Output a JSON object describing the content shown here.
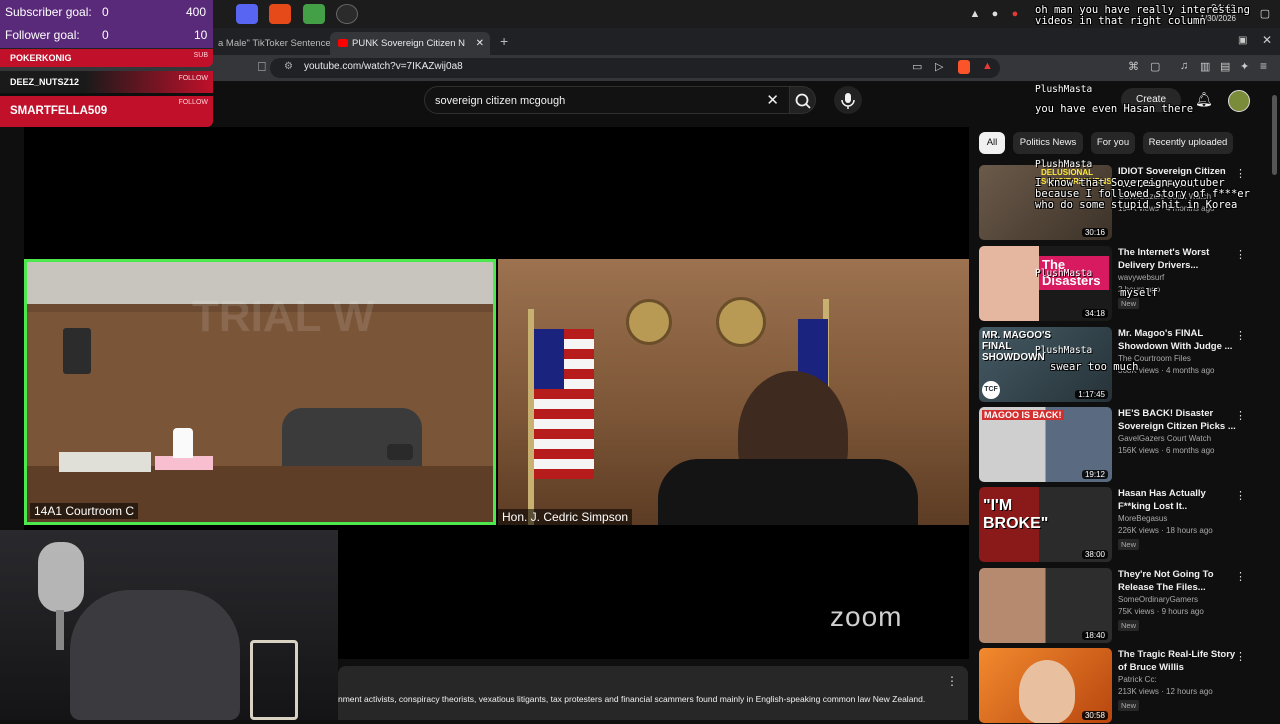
{
  "stream_overlay": {
    "goals": [
      {
        "label": "Subscriber goal:",
        "current": "0",
        "target": "400"
      },
      {
        "label": "Follower goal:",
        "current": "0",
        "target": "10"
      }
    ],
    "alerts": [
      {
        "name": "POKERKONIG",
        "type": "SUB"
      },
      {
        "name": "DEEZ_NUTSZ12",
        "type": "FOLLOW"
      },
      {
        "name": "SMARTFELLA509",
        "type": "FOLLOW"
      }
    ],
    "chat": [
      {
        "user": "",
        "message": "oh man you have really interesting videos in that right column"
      },
      {
        "user": "PlushMasta",
        "message": "you have even Hasan there"
      },
      {
        "user": "PlushMasta",
        "message": "I know that Sovereign youtuber because I followed story of f***er who do some stupid shit in Korea"
      },
      {
        "user": "PlushMasta",
        "message": "myself"
      },
      {
        "user": "PlushMasta",
        "message": "swear too much"
      }
    ]
  },
  "taskbar": {
    "time": "04:41",
    "date": "1/30/2026"
  },
  "browser": {
    "tabs": [
      {
        "label": "a Male\" TikToker Sentence"
      },
      {
        "label": "PUNK Sovereign Citizen N"
      }
    ],
    "url": "youtube.com/watch?v=7IKAZwij0a8"
  },
  "youtube": {
    "search_query": "sovereign citizen mcgough",
    "create_label": "Create",
    "video": {
      "left_pane_label": "14A1 Courtroom C",
      "right_pane_label": "Hon. J. Cedric Simpson",
      "watermark": "TRIAL W",
      "zoom_logo": "zoom"
    },
    "description_text": "nment activists, conspiracy theorists, vexatious litigants, tax protesters and financial scammers found mainly in English-speaking common law New Zealand.",
    "chips": [
      "All",
      "Politics News",
      "For you",
      "Recently uploaded"
    ],
    "recommendations": [
      {
        "title": "IDIOT Sovereign Citizen RETURNS FOR...",
        "channel": "GavelGazers Court Watch",
        "meta": "194K views · 4 months ago",
        "duration": "30:16",
        "badge": "",
        "thumb_text": "DELUSIONAL SOVCIT RETURNS",
        "thumb_color": "#5b4a3a"
      },
      {
        "title": "The Internet's Worst Delivery Drivers...",
        "channel": "wavywebsurf",
        "meta": "2 hours ago",
        "duration": "34:18",
        "badge": "New",
        "thumb_text": "The Disasters",
        "thumb_color": "#c2185b"
      },
      {
        "title": "Mr. Magoo's FINAL Showdown With Judge ...",
        "channel": "The Courtroom Files",
        "meta": "368K views · 4 months ago",
        "duration": "1:17:45",
        "badge": "",
        "thumb_text": "MR. MAGOO'S FINAL SHOWDOWN",
        "thumb_color": "#37474f"
      },
      {
        "title": "HE'S BACK! Disaster Sovereign Citizen Picks ...",
        "channel": "GavelGazers Court Watch",
        "meta": "156K views · 6 months ago",
        "duration": "19:12",
        "badge": "",
        "thumb_text": "MAGOO IS BACK!",
        "thumb_color": "#6d6d6d"
      },
      {
        "title": "Hasan Has Actually F**king Lost It..",
        "channel": "MoreBegasus",
        "meta": "226K views · 18 hours ago",
        "duration": "38:00",
        "badge": "New",
        "thumb_text": "\"I'M BROKE\"",
        "thumb_color": "#8a1a1a"
      },
      {
        "title": "They're Not Going To Release The Files...",
        "channel": "SomeOrdinaryGamers",
        "meta": "75K views · 9 hours ago",
        "duration": "18:40",
        "badge": "New",
        "thumb_text": "",
        "thumb_color": "#9e7b63"
      },
      {
        "title": "The Tragic Real-Life Story of Bruce Willis",
        "channel": "Patrick Cc:",
        "meta": "213K views · 12 hours ago",
        "duration": "30:58",
        "badge": "New",
        "thumb_text": "",
        "thumb_color": "#d86d1f"
      }
    ]
  }
}
